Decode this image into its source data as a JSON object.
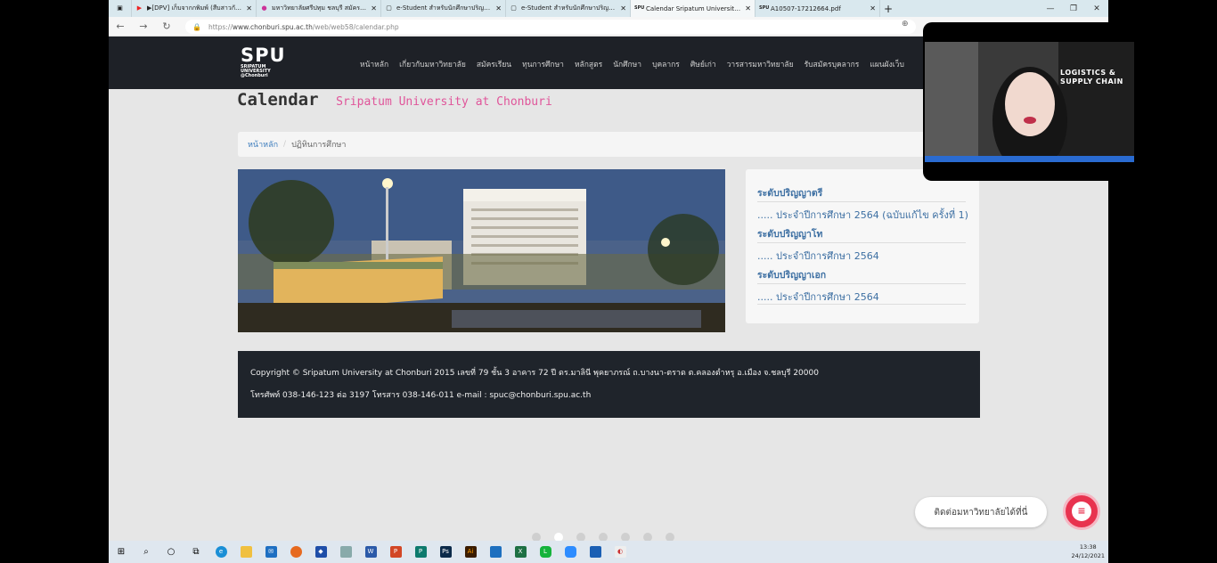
{
  "browser": {
    "tabs": [
      {
        "icon": "youtube-icon",
        "label": "▶[DPV] เก็บจากกพิมพ์ (สืบสาวกัน) -"
      },
      {
        "icon": "site-icon",
        "label": "มหาวิทยาลัยศรีปทุม ชลบุรี สมัครเรียน"
      },
      {
        "icon": "document-icon",
        "label": "e-Student สำหรับนักศึกษาปริญญาตรี"
      },
      {
        "icon": "document-icon",
        "label": "e-Student สำหรับนักศึกษาปริญญาตรี"
      },
      {
        "icon": "spu-icon",
        "label": "Calendar Sripatum University Ch"
      },
      {
        "icon": "spu-icon",
        "label": "A10507-17212664.pdf"
      }
    ],
    "url_prefix": "https://",
    "url_host": "www.chonburi.spu.ac.th",
    "url_path": "/web/web58/calendar.php"
  },
  "site": {
    "logo_main": "SPU",
    "logo_sub1": "SRIPATUM",
    "logo_sub2": "UNIVERSITY",
    "logo_sub3": "@Chonburi",
    "menu": [
      "หน้าหลัก",
      "เกี่ยวกับมหาวิทยาลัย",
      "สมัครเรียน",
      "ทุนการศึกษา",
      "หลักสูตร",
      "นักศึกษา",
      "บุคลากร",
      "ศิษย์เก่า",
      "วารสารมหาวิทยาลัย",
      "รับสมัครบุคลากร",
      "แผนผังเว็บ"
    ]
  },
  "page": {
    "title": "Calendar",
    "subtitle": "Sripatum University at Chonburi",
    "breadcrumb_home": "หน้าหลัก",
    "breadcrumb_sep": "/",
    "breadcrumb_current": "ปฏิทินการศึกษา"
  },
  "sidebar": {
    "sections": [
      {
        "heading": "ระดับปริญญาตรี",
        "link": "..... ประจำปีการศึกษา 2564 (ฉบับแก้ไข ครั้งที่ 1)"
      },
      {
        "heading": "ระดับปริญญาโท",
        "link": "..... ประจำปีการศึกษา 2564"
      },
      {
        "heading": "ระดับปริญญาเอก",
        "link": "..... ประจำปีการศึกษา 2564"
      }
    ]
  },
  "footer": {
    "line1": "Copyright © Sripatum University at Chonburi 2015 เลขที่ 79 ชั้น 3 อาคาร 72 ปี ดร.มาลินี พุคยาภรณ์ ถ.บางนา-ตราด ต.คลองตำหรุ อ.เมือง จ.ชลบุรี 20000",
    "line2": "โทรศัพท์ 038-146-123 ต่อ 3197 โทรสาร 038-146-011 e-mail : spuc@chonburi.spu.ac.th"
  },
  "chat": {
    "label": "ติดต่อมหาวิทยาลัยได้ที่นี่"
  },
  "video": {
    "line1": "LOGISTICS &",
    "line2": "SUPPLY CHAIN"
  },
  "taskbar": {
    "time": "13:38",
    "date": "24/12/2021"
  },
  "carousel": {
    "active_index": 1,
    "count": 7
  }
}
